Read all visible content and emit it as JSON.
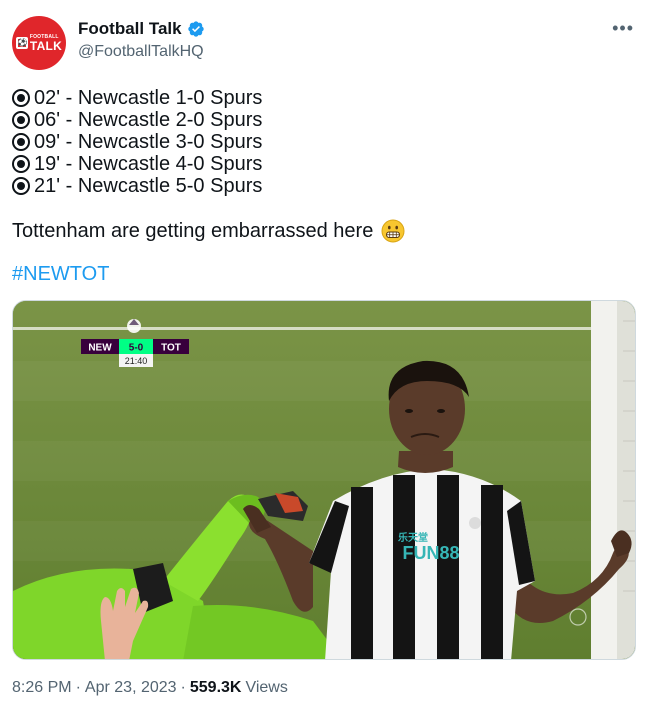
{
  "account": {
    "display_name": "Football Talk",
    "handle": "@FootballTalkHQ",
    "avatar_text_top": "FOOTBALL",
    "avatar_text_main": "TALK",
    "brand_color": "#e0262b",
    "verified_color": "#1d9bf0"
  },
  "more_label": "•••",
  "tweet": {
    "goals": [
      "02' - Newcastle 1-0 Spurs",
      "06' - Newcastle 2-0 Spurs",
      "09' - Newcastle 3-0 Spurs",
      "19' - Newcastle 4-0 Spurs",
      "21' - Newcastle 5-0 Spurs"
    ],
    "caption": "Tottenham are getting embarrassed here",
    "emoji": "grimacing-face",
    "hashtag": "#NEWTOT"
  },
  "scoreboard": {
    "home": "NEW",
    "score": "5-0",
    "away": "TOT",
    "clock": "21:40"
  },
  "footer": {
    "time": "8:26 PM",
    "date": "Apr 23, 2023",
    "views_count": "559.3K",
    "views_label": "Views",
    "separator": "·"
  }
}
